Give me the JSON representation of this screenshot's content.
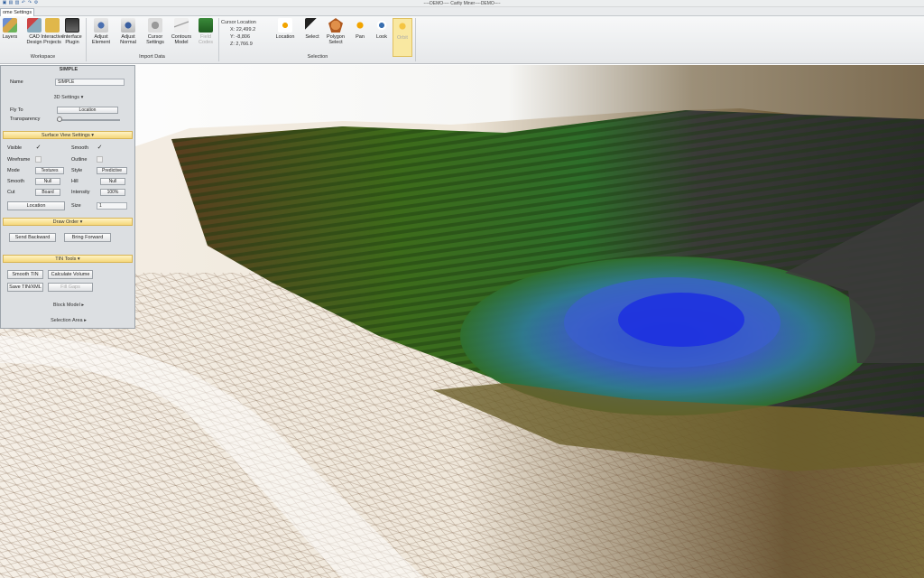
{
  "app": {
    "title": "----DEMO---- Carlty Miner----DEMO----",
    "quick_access": [
      "open",
      "save",
      "print",
      "undo",
      "redo",
      "settings"
    ]
  },
  "tabs": {
    "active": "Home",
    "items": [
      "Home",
      "Settings"
    ],
    "label": "ome  Settings"
  },
  "ribbon": {
    "workspace": {
      "label": "Workspace",
      "buttons": [
        {
          "label": "Layers",
          "icon": "layers-icon"
        },
        {
          "label": "CAD\nDesign",
          "icon": "cad-design-icon"
        },
        {
          "label": "Interactive\nProjects",
          "icon": "interactive-projects-icon"
        },
        {
          "label": "Interface\nPlugin",
          "icon": "interface-plugin-icon"
        }
      ]
    },
    "import_data": {
      "label": "Import Data",
      "buttons": [
        {
          "label": "Adjust\nElement",
          "icon": "adjust-element-icon"
        },
        {
          "label": "Adjust\nNormal",
          "icon": "adjust-normal-icon"
        },
        {
          "label": "Cursor\nSettings",
          "icon": "cursor-settings-icon"
        },
        {
          "label": "Contours\nModel",
          "icon": "contours-model-icon"
        },
        {
          "label": "Field\nCodes",
          "icon": "field-codes-icon"
        }
      ]
    },
    "cursor_location": {
      "heading": "Cursor Location",
      "x": "X: 22,499.2",
      "y": "Y: -8,806",
      "z": "Z: 2,766.9"
    },
    "selection": {
      "label": "Selection",
      "buttons": [
        {
          "label": "Location",
          "icon": "location-icon"
        },
        {
          "label": "Select",
          "icon": "select-arrow-icon"
        },
        {
          "label": "Polygon\nSelect",
          "icon": "polygon-select-icon"
        },
        {
          "label": "Pan",
          "icon": "pan-icon"
        },
        {
          "label": "Look",
          "icon": "look-icon"
        },
        {
          "label": "Orbit",
          "icon": "orbit-icon"
        }
      ]
    }
  },
  "panel": {
    "title": "SIMPLE",
    "name_label": "Name",
    "name_value": "SIMPLE",
    "settings_3d": "3D Settings ▾",
    "fly_to_label": "Fly To",
    "fly_to_value": "Location",
    "transparency_label": "Transparency",
    "transparency_value": 0.0,
    "surface_view_settings": "Surface View Settings ▾",
    "visible_label": "Visible",
    "visible": true,
    "smooth_label": "Smooth",
    "smooth": true,
    "wireframe_label": "Wireframe",
    "wireframe": false,
    "outline_label": "Outline",
    "outline": false,
    "mode_label": "Mode",
    "mode_value": "Textures",
    "style_label": "Style",
    "style_value": "Predictive",
    "smooth2_label": "Smooth",
    "smooth2_value": "Null",
    "hill_label": "Hill",
    "hill_value": "Null",
    "cut_label": "Cut",
    "cut_value": "Board",
    "intensity_label": "Intensity",
    "intensity_value": "100%",
    "location_button": "Location",
    "size_label": "Size",
    "size_value": "1",
    "draw_order": "Draw Order ▾",
    "send_backward": "Send Backward",
    "bring_forward": "Bring Forward",
    "tin_tools": "TIN Tools ▾",
    "smooth_tin": "Smooth TIN",
    "calculate_volume": "Calculate Volume",
    "save_tin": "Save TIN/XML",
    "fill_gaps": "Fill Gaps",
    "block_model": "Block Model ▸",
    "selection_area": "Selection Area ▸"
  },
  "colors": {
    "ribbon_bg": "#eceef0",
    "panel_bg": "#dcdfe2",
    "section_gold": "#f5d77a",
    "pit_green": "#3f9a24",
    "pit_blue": "#2a4fc9",
    "terrain_brown": "#8a5a3a"
  }
}
